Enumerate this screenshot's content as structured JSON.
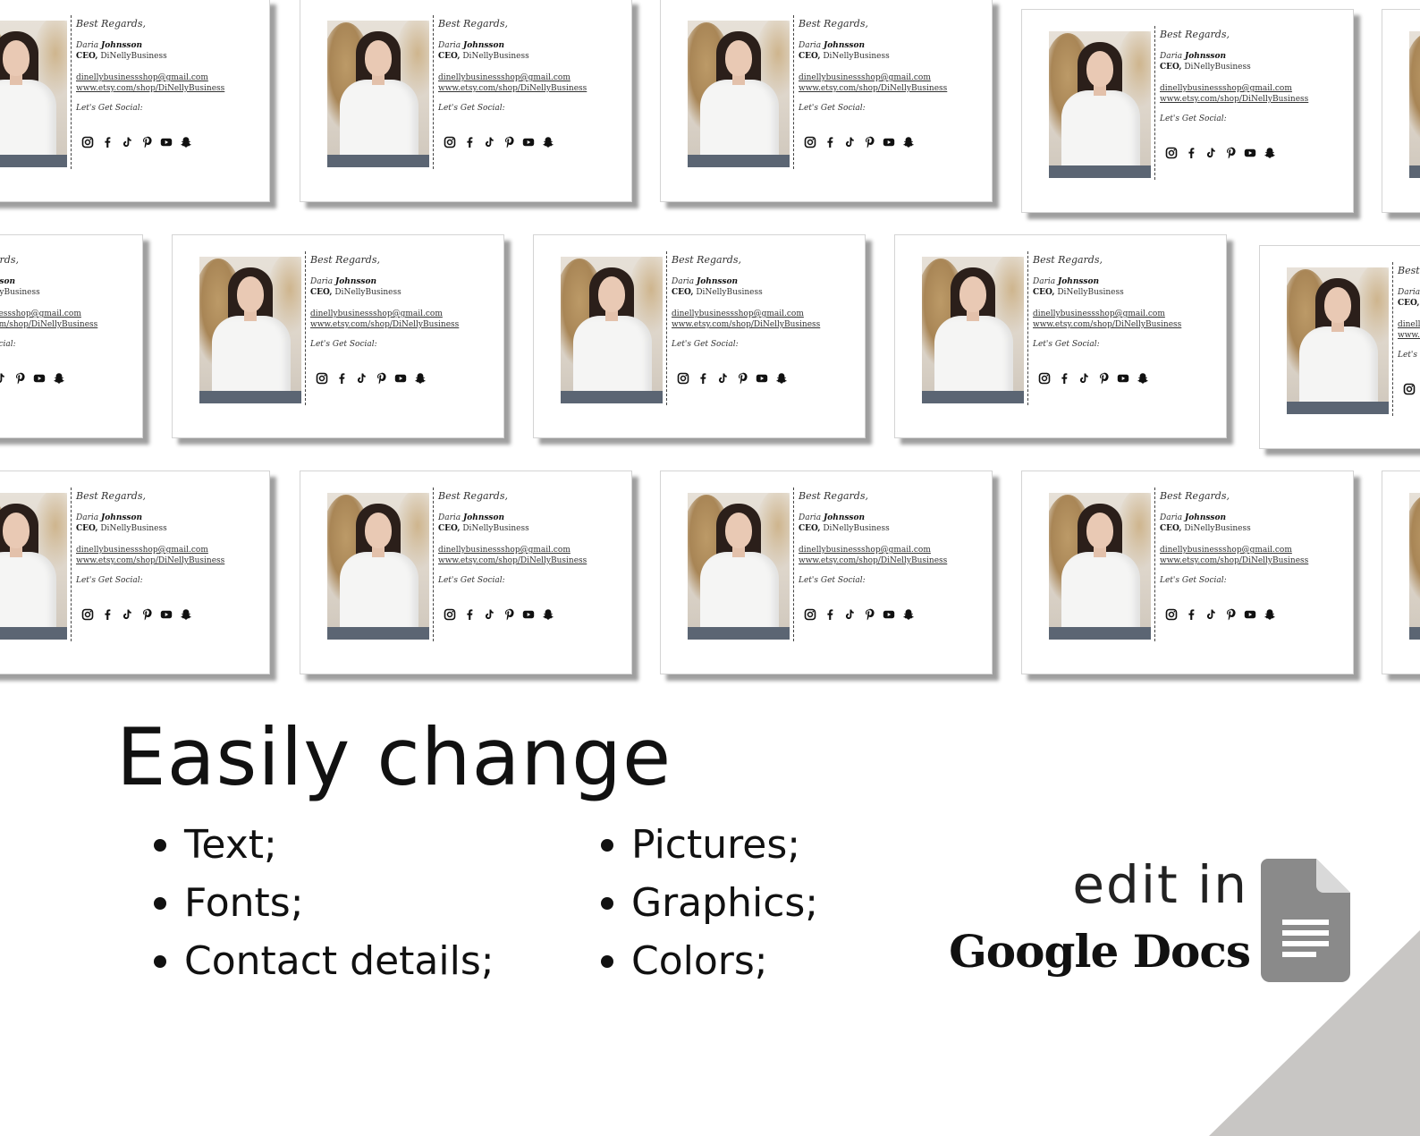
{
  "signature": {
    "greeting": "Best Regards,",
    "first_name": "Daria",
    "last_name": "Johnsson",
    "title": "CEO,",
    "company": "DiNellyBusiness",
    "email": "dinellybusinessshop@gmail.com",
    "website": "www.etsy.com/shop/DiNellyBusiness",
    "social_label": "Let's Get Social:",
    "social_icons": [
      "instagram-icon",
      "facebook-icon",
      "tiktok-icon",
      "pinterest-icon",
      "youtube-icon",
      "snapchat-icon"
    ]
  },
  "headline": "Easily change",
  "features_left": [
    "Text;",
    "Fonts;",
    "Contact details;"
  ],
  "features_right": [
    "Pictures;",
    "Graphics;",
    "Colors;"
  ],
  "edit_label": "edit in",
  "product_name": "Google Docs",
  "colors": {
    "background": "#ffffff",
    "text": "#111111",
    "docs_icon": "#8a8a8a",
    "corner": "#c8c6c4"
  }
}
